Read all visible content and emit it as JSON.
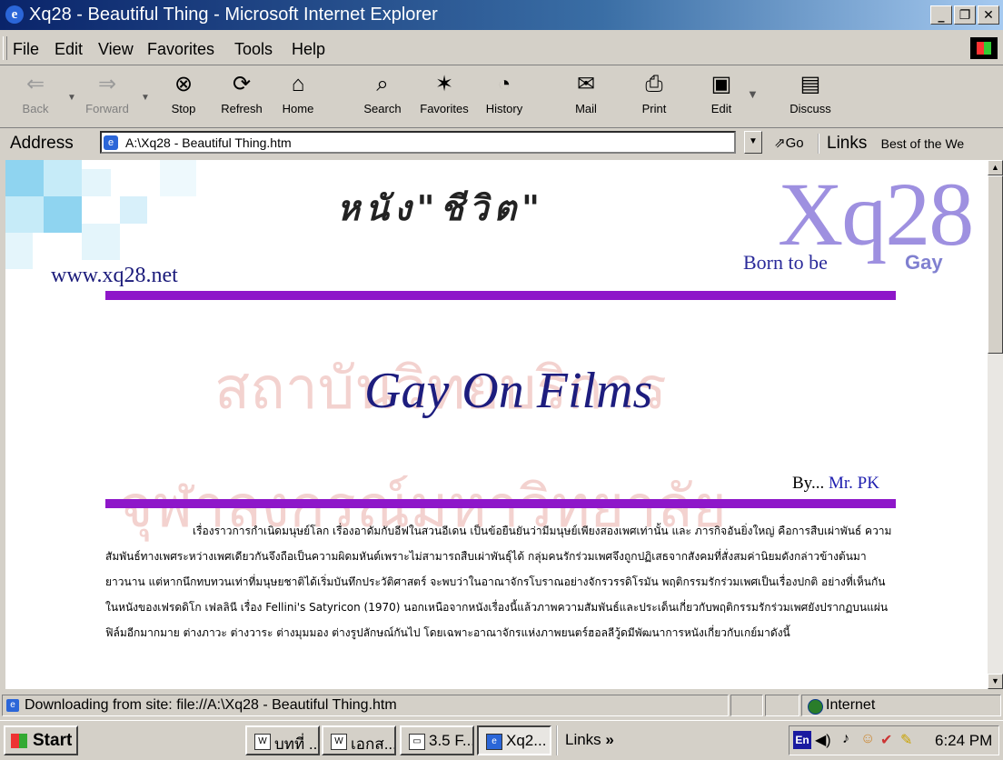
{
  "window": {
    "title": "Xq28 - Beautiful Thing - Microsoft Internet Explorer",
    "buttons": [
      "_",
      "ð",
      "x"
    ]
  },
  "menu": [
    "File",
    "Edit",
    "View",
    "Favorites",
    "Tools",
    "Help"
  ],
  "toolbar": {
    "back": "Back",
    "forward": "Forward",
    "stop": "Stop",
    "refresh": "Refresh",
    "home": "Home",
    "search": "Search",
    "favorites": "Favorites",
    "history": "History",
    "mail": "Mail",
    "print": "Print",
    "edit": "Edit",
    "discuss": "Discuss"
  },
  "address": {
    "label": "Address",
    "value": "A:\\Xq28 - Beautiful Thing.htm",
    "go": "Go",
    "links": "Links",
    "link1": "Best of the We"
  },
  "page": {
    "heading_thai": "หนัง\"ชีวิต\"",
    "site": "www.xq28.net",
    "logo": "Xq28",
    "tagline": "Born to be",
    "tagline_gay": "Gay",
    "title": "Gay On Films",
    "by": "By...",
    "author": "Mr. PK",
    "body": "เรื่องราวการกำเนิดมนุษย์โลก เรื่องอาดัมกับอีฟในสวนอีเดน เป็นข้อยืนยันว่ามีมนุษย์เพียงสองเพศเท่านั้น และ ภารกิจอันยิ่งใหญ่ คือการสืบเผ่าพันธ์ ความสัมพันธ์ทางเพศระหว่างเพศเดียวกันจึงถือเป็นความผิดมหันต์เพราะไม่สามารถสืบเผ่าพันธุ์ได้ กลุ่มคนรักร่วมเพศจึงถูกปฏิเสธจากสังคมที่สั่งสมค่านิยมดังกล่าวข้างต้นมายาวนาน แต่หากนึกทบทวนเท่าที่มนุษยชาติได้เริ่มบันทึกประวัติศาสตร์ จะพบว่าในอาณาจักรโบราณอย่างจักรวรรดิโรมัน พฤติกรรมรักร่วมเพศเป็นเรื่องปกติ อย่างที่เห็นกันในหนังของเฟรดดิโก เฟลลินี เรื่อง Fellini's Satyricon (1970) นอกเหนือจากหนังเรื่องนี้แล้วภาพความสัมพันธ์และประเด็นเกี่ยวกับพฤติกรรมรักร่วมเพศยังปรากฏบนแผ่นฟิล์มอีกมากมาย ต่างภาวะ ต่างวาระ ต่างมุมมอง ต่างรูปลักษณ์กันไป โดยเฉพาะอาณาจักรแห่งภาพยนตร์ฮอลลีวู้ดมีพัฒนาการหนังเกี่ยวกับเกย์มาดังนี้",
    "watermark1": "สถาบันวิทยบริการ",
    "watermark2": "จุฬาลงกรณ์มหาวิทยาลัย"
  },
  "status": {
    "message": "Downloading from site: file://A:\\Xq28 - Beautiful Thing.htm",
    "zone": "Internet"
  },
  "taskbar": {
    "start": "Start",
    "tasks": [
      "บทที่ ...",
      "เอกส...",
      "3.5 F...",
      "Xq2..."
    ],
    "links": "Links",
    "links_more": "»",
    "lang": "En",
    "time": "6:24 PM"
  }
}
